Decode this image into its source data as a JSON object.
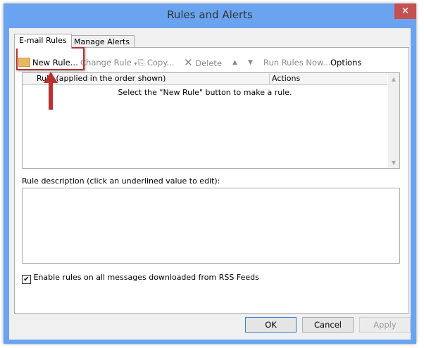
{
  "window": {
    "title": "Rules and Alerts",
    "close_icon": "×"
  },
  "tabs": [
    {
      "label": "E-mail Rules",
      "active": true
    },
    {
      "label": "Manage Alerts",
      "active": false
    }
  ],
  "toolbar": {
    "new_rule": "New Rule...",
    "change_rule": "Change Rule",
    "copy": "Copy...",
    "delete": "Delete",
    "run_rules_now": "Run Rules Now...",
    "options": "Options"
  },
  "rules_list": {
    "columns": [
      "Rule (applied in the order shown)",
      "Actions"
    ],
    "empty_message": "Select the \"New Rule\" button to make a rule."
  },
  "description": {
    "label": "Rule description (click an underlined value to edit):"
  },
  "rss_checkbox": {
    "label": "Enable rules on all messages downloaded from RSS Feeds",
    "checked": true
  },
  "buttons": {
    "ok": "OK",
    "cancel": "Cancel",
    "apply": "Apply"
  },
  "colors": {
    "frame": "#6aa4f1",
    "close": "#c75050",
    "highlight": "#b8312f"
  }
}
